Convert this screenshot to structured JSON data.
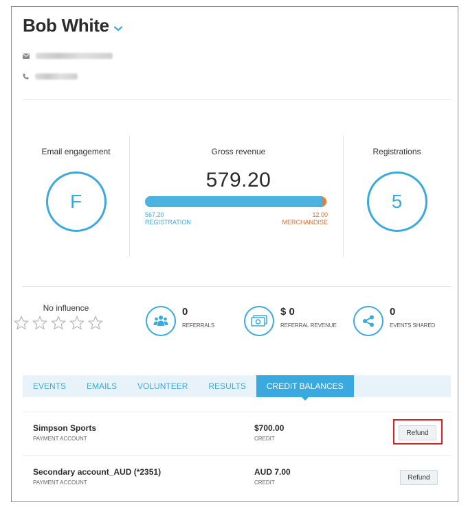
{
  "contact": {
    "name": "Bob White"
  },
  "stats": {
    "email_engagement": {
      "title": "Email engagement",
      "grade": "F"
    },
    "gross_revenue": {
      "title": "Gross revenue",
      "value": "579.20",
      "registration_amount": "567.20",
      "registration_label": "REGISTRATION",
      "merchandise_amount": "12.00",
      "merchandise_label": "MERCHANDISE",
      "registration_fraction": 0.979
    },
    "registrations": {
      "title": "Registrations",
      "count": "5"
    }
  },
  "social": {
    "influence_label": "No influence",
    "influence_stars": 0,
    "referrals": {
      "value": "0",
      "label": "REFERRALS"
    },
    "referral_revenue": {
      "value": "$ 0",
      "label": "REFERRAL REVENUE"
    },
    "events_shared": {
      "value": "0",
      "label": "EVENTS SHARED"
    }
  },
  "tabs": [
    {
      "label": "EVENTS",
      "active": false
    },
    {
      "label": "EMAILS",
      "active": false
    },
    {
      "label": "VOLUNTEER",
      "active": false
    },
    {
      "label": "RESULTS",
      "active": false
    },
    {
      "label": "CREDIT BALANCES",
      "active": true
    }
  ],
  "credit_balances": [
    {
      "account": "Simpson Sports",
      "account_type": "PAYMENT ACCOUNT",
      "amount": "$700.00",
      "amount_type": "CREDIT",
      "action": "Refund"
    },
    {
      "account": "Secondary account_AUD (*2351)",
      "account_type": "PAYMENT ACCOUNT",
      "amount": "AUD 7.00",
      "amount_type": "CREDIT",
      "action": "Refund"
    }
  ],
  "colors": {
    "accent": "#3aa9df",
    "merchandise": "#e36a2a",
    "highlight": "#e02020"
  }
}
